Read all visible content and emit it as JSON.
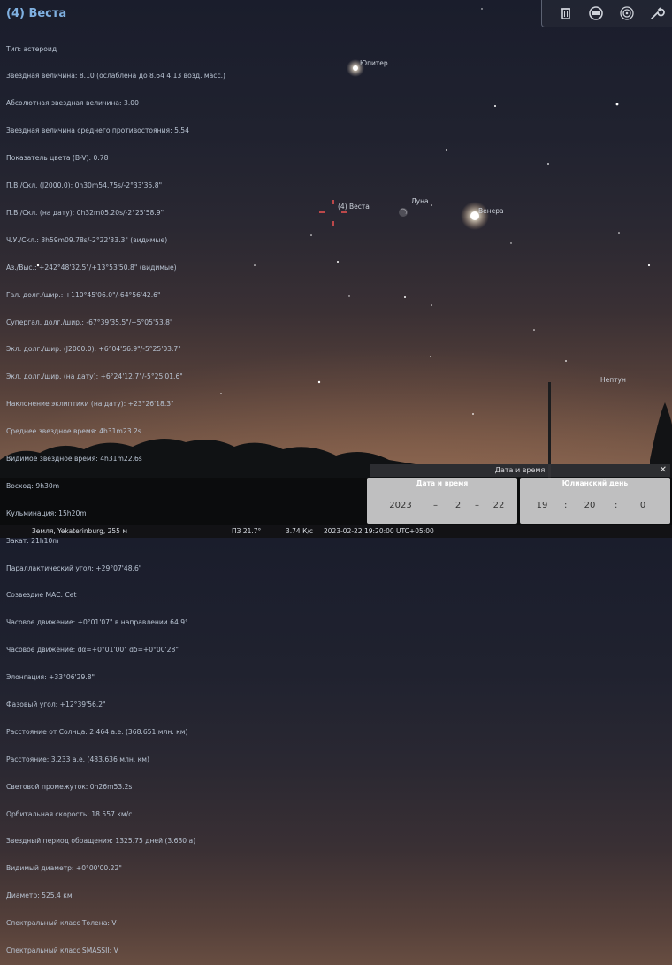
{
  "info": {
    "title": "(4) Веста",
    "lines": [
      "Тип: астероид",
      "Звездная величина: 8.10 (ослаблена до 8.64 4.13 возд. масс.)",
      "Абсолютная звездная величина: 3.00",
      "Звездная величина среднего противостояния: 5.54",
      "Показатель цвета (B-V): 0.78",
      "П.В./Скл. (J2000.0): 0h30m54.75s/-2°33'35.8\"",
      "П.В./Скл. (на дату): 0h32m05.20s/-2°25'58.9\"",
      "Ч.У./Скл.: 3h59m09.78s/-2°22'33.3\" (видимые)",
      "Аз./Выс.: +242°48'32.5\"/+13°53'50.8\" (видимые)",
      "Гал. долг./шир.: +110°45'06.0\"/-64°56'42.6\"",
      "Супергал. долг./шир.: -67°39'35.5\"/+5°05'53.8\"",
      "Экл. долг./шир. (J2000.0): +6°04'56.9\"/-5°25'03.7\"",
      "Экл. долг./шир. (на дату): +6°24'12.7\"/-5°25'01.6\"",
      "Наклонение эклиптики (на дату): +23°26'18.3\"",
      "Среднее звездное время: 4h31m23.2s",
      "Видимое звездное время: 4h31m22.6s",
      "Восход: 9h30m",
      "Кульминация: 15h20m",
      "Закат: 21h10m",
      "Параллактический угол: +29°07'48.6\"",
      "Созвездие МАС: Cet",
      "Часовое движение: +0°01'07\" в направлении 64.9°",
      "Часовое движение: dα=+0°01'00\" dδ=+0°00'28\"",
      "Элонгация: +33°06'29.8\"",
      "Фазовый угол: +12°39'56.2\"",
      "Расстояние от Солнца: 2.464 а.е. (368.651 млн. км)",
      "Расстояние: 3.233 а.е. (483.636 млн. км)",
      "Световой промежуток: 0h26m53.2s",
      "Орбитальная скорость: 18.557 км/с",
      "Звездный период обращения: 1325.75 дней (3.630 a)",
      "Видимый диаметр: +0°00'00.22\"",
      "Диаметр: 525.4 км",
      "Спектральный класс Толена: V",
      "Спектральный класс SMASSII: V"
    ]
  },
  "sky_labels": {
    "jupiter": "Юпитер",
    "vesta": "(4) Веста",
    "moon": "Луна",
    "venus": "Венера",
    "neptune": "Нептун"
  },
  "toolbar": {
    "icons": [
      "trash-icon",
      "display-icon",
      "target-icon",
      "wrench-icon"
    ]
  },
  "datetime": {
    "title": "Дата и время",
    "close": "✕",
    "date_header": "Дата и время",
    "jd_header": "Юлианский день",
    "year": "2023",
    "month": "2",
    "day": "22",
    "hour": "19",
    "minute": "20",
    "second": "0",
    "sep_dash": "–",
    "sep_colon": ":"
  },
  "status": {
    "location": "Земля, Yekaterinburg, 255 м",
    "fov": "ПЗ 21.7°",
    "fps": "3.74 К/с",
    "datetime": "2023-02-22 19:20:00 UTC+05:00"
  },
  "colors": {
    "title": "#7fb0e0",
    "info_text": "#b8c3d2",
    "marker": "#e05050"
  }
}
